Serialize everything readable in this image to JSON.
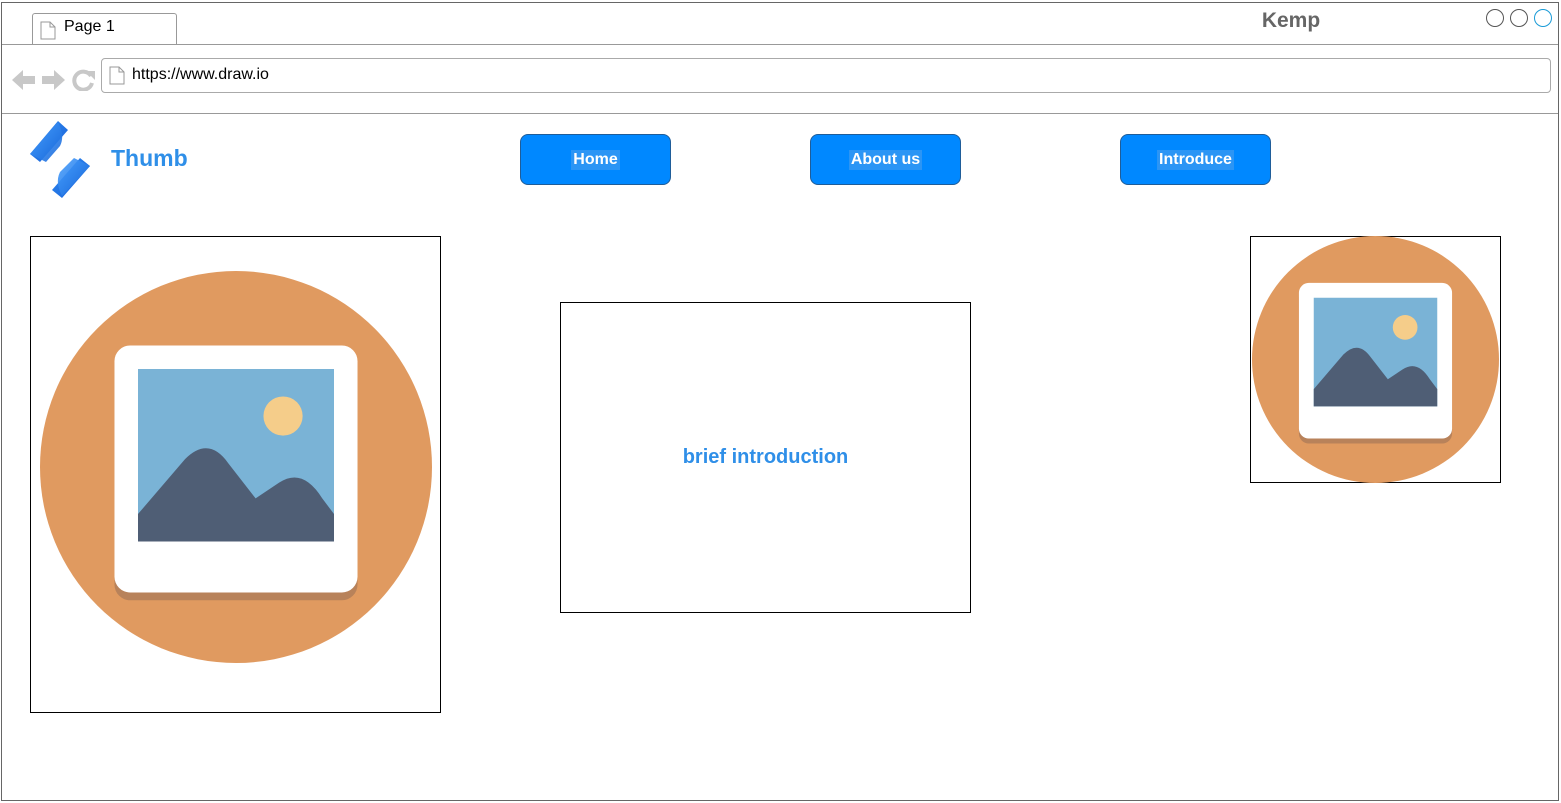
{
  "browser": {
    "tab_label": "Page 1",
    "window_title": "Kemp",
    "url": "https://www.draw.io",
    "icons": [
      "doc-icon",
      "back-icon",
      "forward-icon",
      "reload-icon",
      "window-control-icon"
    ]
  },
  "header": {
    "brand": "Thumb",
    "logo_icon": "lightning-logo-icon",
    "nav": [
      {
        "label": "Home"
      },
      {
        "label": "About us"
      },
      {
        "label": "Introduce"
      }
    ]
  },
  "main": {
    "intro_text": "brief introduction",
    "images": [
      "image-placeholder-icon",
      "image-placeholder-icon"
    ]
  },
  "colors": {
    "accent": "#0088ff",
    "brand_text": "#2f8fe8",
    "placeholder_circle": "#e09a60",
    "sky": "#7ab3d6",
    "mountain": "#4f5e75",
    "sun": "#f5cd8a"
  }
}
